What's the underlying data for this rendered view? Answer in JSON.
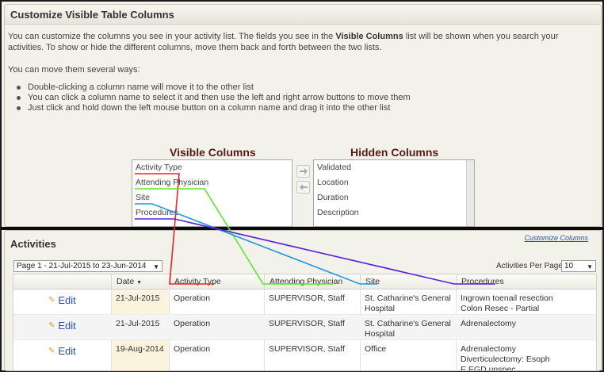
{
  "customize_panel": {
    "title": "Customize Visible Table Columns",
    "intro_part1": "You can customize the columns you see in your activity list. The fields you see in the ",
    "intro_bold": "Visible Columns",
    "intro_part2": " list will be shown when you search your activities. To show or hide the different columns, move them back and forth between the two lists.",
    "ways": "You can move them several ways:",
    "bullets": [
      "Double-clicking a column name will move it to the other list",
      "You can click a column name to select it and then use the left and right arrow buttons to move them",
      "Just click and hold down the left mouse button on a column name and drag it into the other list"
    ],
    "visible_heading": "Visible Columns",
    "hidden_heading": "Hidden Columns",
    "visible_columns": [
      "Activity Type",
      "Attending Physician",
      "Site",
      "Procedures"
    ],
    "hidden_columns": [
      "Validated",
      "Location",
      "Duration",
      "Description"
    ]
  },
  "activities_panel": {
    "title": "Activities",
    "customize_link": "Customize Columns",
    "page_select": "Page 1 - 21-Jul-2015 to 23-Jun-2014",
    "per_page_label": "Activities Per Page:",
    "per_page_value": "10",
    "headers": [
      "Date",
      "Activity Type",
      "Attending Physician",
      "Site",
      "Procedures"
    ],
    "edit_label": "Edit",
    "rows": [
      {
        "date": "21-Jul-2015",
        "type": "Operation",
        "physician": "SUPERVISOR, Staff",
        "site_line1": "St. Catharine's General",
        "site_line2": "Hospital",
        "proc_line1": "Ingrown toenail resection",
        "proc_line2": "Colon Resec - Partial",
        "proc_line3": ""
      },
      {
        "date": "21-Jul-2015",
        "type": "Operation",
        "physician": "SUPERVISOR, Staff",
        "site_line1": "St. Catharine's General",
        "site_line2": "Hospital",
        "proc_line1": "Adrenalectomy",
        "proc_line2": "",
        "proc_line3": ""
      },
      {
        "date": "19-Aug-2014",
        "type": "Operation",
        "physician": "SUPERVISOR, Staff",
        "site_line1": "Office",
        "site_line2": "",
        "proc_line1": "Adrenalectomy",
        "proc_line2": "Diverticulectomy: Esoph",
        "proc_line3": "E EGD unspec"
      }
    ]
  },
  "colors": {
    "activity_type_line": "#e8252b",
    "attending_physician_line": "#5fe62a",
    "site_line": "#1f97e6",
    "procedures_line": "#5a1fd6"
  }
}
